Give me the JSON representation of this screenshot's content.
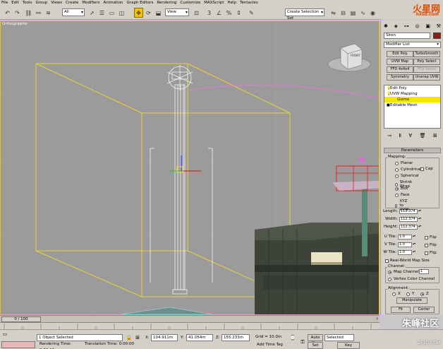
{
  "menu": [
    "File",
    "Edit",
    "Tools",
    "Group",
    "Views",
    "Create",
    "Modifiers",
    "Animation",
    "Graph Editors",
    "Rendering",
    "Customize",
    "MAXScript",
    "Help",
    "Tentacles"
  ],
  "toolbar": {
    "selection_filter": "All",
    "ref_coord": "View",
    "named_selection": "Create Selection Set"
  },
  "logo": {
    "title": "火星网",
    "subtitle": "hxsd.com"
  },
  "viewport": {
    "label": "Orthographic",
    "viewcube_label": "FRONT"
  },
  "panel": {
    "object_name": "Siren",
    "object_color": "#8b1c1c",
    "modifier_list": "Modifier List",
    "modifier_buttons": [
      "Edit Poly",
      "TurboSmooth",
      "UVW Map",
      "Poly Select",
      "FFD 4x4x4",
      "FFD Select",
      "Symmetry",
      "Unwrap UVW"
    ],
    "stack": [
      {
        "label": "Edit Poly",
        "sub": false,
        "selected": false
      },
      {
        "label": "UVW Mapping",
        "sub": false,
        "selected": false
      },
      {
        "label": "Gizmo",
        "sub": true,
        "selected": true
      },
      {
        "label": "Editable Mesh",
        "sub": false,
        "selected": false
      }
    ],
    "rollout_title": "Parameters",
    "mapping_label": "Mapping:",
    "mapping_options": [
      "Planar",
      "Cylindrical",
      "Spherical",
      "Shrink Wrap",
      "Box",
      "Face",
      "XYZ to UVW"
    ],
    "mapping_selected": "Box",
    "cap_label": "Cap",
    "length_label": "Length:",
    "length_value": "112.374",
    "width_label": "Width:",
    "width_value": "112.374",
    "height_label": "Height:",
    "height_value": "112.374",
    "utile_label": "U Tile:",
    "utile_value": "1.0",
    "vtile_label": "V Tile:",
    "vtile_value": "1.0",
    "wtile_label": "W Tile:",
    "wtile_value": "1.0",
    "flip_label": "Flip",
    "realworld_label": "Real-World Map Size",
    "channel_label": "Channel:",
    "map_channel_label": "Map Channel:",
    "map_channel_value": "1",
    "vertex_color_label": "Vertex Color Channel",
    "alignment_label": "Alignment:",
    "axis_x": "X",
    "axis_y": "Y",
    "axis_z": "Z",
    "manipulate_label": "Manipulate",
    "fit_label": "Fit",
    "center_label": "Center"
  },
  "timeline": {
    "slider": "0 / 100"
  },
  "status": {
    "selected_text": "1 Object Selected",
    "render_time": "Rendering Time: 0:00:19",
    "translation_time": "Translation Time: 0:00:00",
    "x_label": "X:",
    "x_value": "104.911m",
    "y_label": "Y:",
    "y_value": "41.054m",
    "z_label": "Z:",
    "z_value": "155.233m",
    "grid": "Grid = 10.0m",
    "add_time_tag": "Add Time Tag",
    "auto_key": "Auto Key",
    "set_key": "Set Key",
    "key_mode": "Selected",
    "key_filters": "Key Filters..."
  },
  "watermark": {
    "text": "朱峰社区",
    "sub": "ZF3D.COM"
  }
}
